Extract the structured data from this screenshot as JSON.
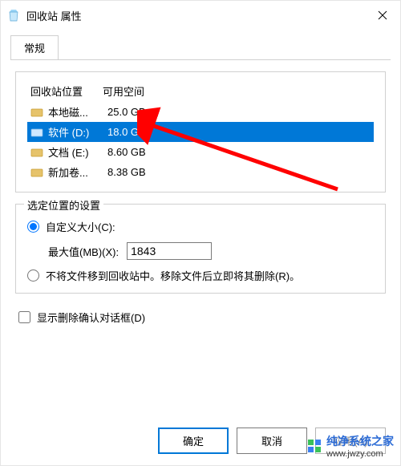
{
  "titlebar": {
    "title": "回收站 属性"
  },
  "tabs": {
    "general": "常规"
  },
  "table": {
    "header_location": "回收站位置",
    "header_space": "可用空间",
    "rows": [
      {
        "label": "本地磁...",
        "space": "25.0 GB"
      },
      {
        "label": "软件 (D:)",
        "space": "18.0 GB"
      },
      {
        "label": "文档 (E:)",
        "space": "8.60 GB"
      },
      {
        "label": "新加卷...",
        "space": "8.38 GB"
      }
    ]
  },
  "settings": {
    "legend": "选定位置的设置",
    "custom_size": "自定义大小(C):",
    "max_label": "最大值(MB)(X):",
    "max_value": "1843",
    "do_not_move": "不将文件移到回收站中。移除文件后立即将其删除(R)。"
  },
  "confirm": {
    "label": "显示删除确认对话框(D)"
  },
  "buttons": {
    "ok": "确定",
    "cancel": "取消",
    "apply": "应用(A)"
  },
  "watermark": {
    "brand": "纯净系统之家",
    "url": "www.jwzy.com"
  }
}
